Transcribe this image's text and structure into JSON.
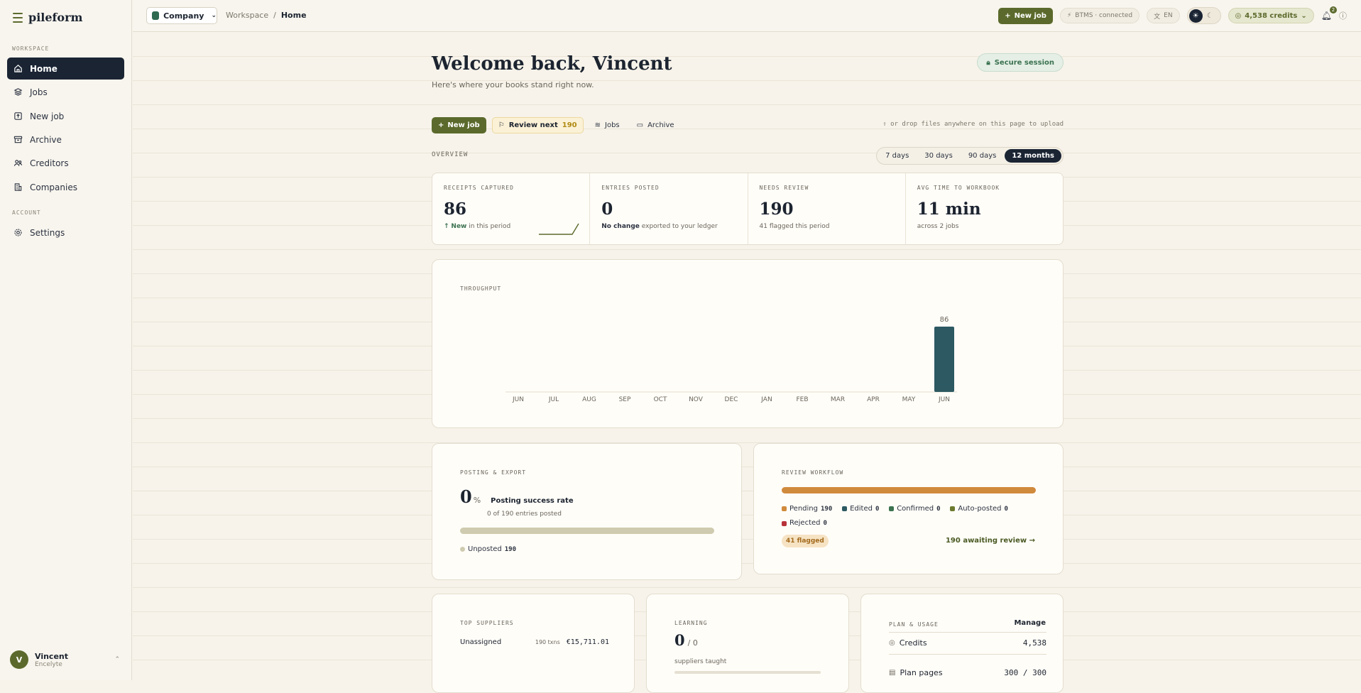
{
  "brand": {
    "name": "pileform"
  },
  "sidebar": {
    "section_workspace": "WORKSPACE",
    "section_account": "ACCOUNT",
    "items": [
      {
        "label": "Home",
        "icon": "home-icon"
      },
      {
        "label": "Jobs",
        "icon": "layers-icon"
      },
      {
        "label": "New job",
        "icon": "upload-icon"
      },
      {
        "label": "Archive",
        "icon": "archive-icon"
      },
      {
        "label": "Creditors",
        "icon": "users-icon"
      },
      {
        "label": "Companies",
        "icon": "building-icon"
      }
    ],
    "settings_label": "Settings",
    "user": {
      "initial": "V",
      "name": "Vincent",
      "company": "Encelyte"
    }
  },
  "topbar": {
    "company_label": "Company",
    "breadcrumb_parent": "Workspace",
    "breadcrumb_sep": "/",
    "breadcrumb_current": "Home",
    "new_job": "New job",
    "btms_status": "BTMS · connected",
    "language": "EN",
    "credits": "4,538 credits",
    "notifications_count": "2"
  },
  "header": {
    "title": "Welcome back, Vincent",
    "subtitle": "Here's where your books stand right now.",
    "secure_session": "Secure session"
  },
  "actions": {
    "new_job": "New job",
    "review_next": "Review next",
    "review_count": "190",
    "jobs": "Jobs",
    "archive": "Archive",
    "drop_hint": "or drop files anywhere on this page to upload"
  },
  "overview": {
    "label": "OVERVIEW",
    "periods": [
      "7 days",
      "30 days",
      "90 days",
      "12 months"
    ],
    "active_period": "12 months"
  },
  "kpis": [
    {
      "label": "RECEIPTS CAPTURED",
      "value": "86",
      "note_strong": "New",
      "note": "in this period"
    },
    {
      "label": "ENTRIES POSTED",
      "value": "0",
      "note_strong": "No change",
      "note": "exported to your ledger"
    },
    {
      "label": "NEEDS REVIEW",
      "value": "190",
      "note_strong": "",
      "note": "41 flagged this period"
    },
    {
      "label": "AVG TIME TO WORKBOOK",
      "value": "11 min",
      "note_strong": "",
      "note": "across 2 jobs"
    }
  ],
  "throughput": {
    "label": "THROUGHPUT"
  },
  "chart_data": {
    "type": "bar",
    "title": "THROUGHPUT",
    "categories": [
      "JUN",
      "JUL",
      "AUG",
      "SEP",
      "OCT",
      "NOV",
      "DEC",
      "JAN",
      "FEB",
      "MAR",
      "APR",
      "MAY",
      "JUN"
    ],
    "values": [
      0,
      0,
      0,
      0,
      0,
      0,
      0,
      0,
      0,
      0,
      0,
      0,
      86
    ],
    "data_labels": [
      "",
      "",
      "",
      "",
      "",
      "",
      "",
      "",
      "",
      "",
      "",
      "",
      "86"
    ],
    "bar_color": "#2c5962",
    "ylim": [
      0,
      86
    ]
  },
  "posting": {
    "label": "POSTING & EXPORT",
    "rate_value": "0",
    "rate_unit": "%",
    "rate_label": "Posting success rate",
    "rate_detail": "0 of 190 entries posted",
    "unposted_label": "Unposted",
    "unposted_count": "190",
    "progress_fraction": 0
  },
  "review": {
    "label": "REVIEW WORKFLOW",
    "legend": [
      {
        "label": "Pending",
        "count": "190",
        "color": "#d08a3c"
      },
      {
        "label": "Edited",
        "count": "0",
        "color": "#2c5962"
      },
      {
        "label": "Confirmed",
        "count": "0",
        "color": "#3b7250"
      },
      {
        "label": "Auto-posted",
        "count": "0",
        "color": "#6b7a2e"
      },
      {
        "label": "Rejected",
        "count": "0",
        "color": "#b8323a"
      }
    ],
    "flagged": "41 flagged",
    "awaiting": "190 awaiting review →"
  },
  "suppliers": {
    "label": "TOP SUPPLIERS",
    "rows": [
      {
        "name": "Unassigned",
        "txns": "190 txns",
        "amount": "€15,711.01"
      }
    ]
  },
  "learning": {
    "label": "LEARNING",
    "value": "0",
    "total": "/ 0",
    "note": "suppliers taught"
  },
  "plan": {
    "label": "PLAN & USAGE",
    "manage": "Manage",
    "credits_label": "Credits",
    "credits_value": "4,538",
    "pages_label": "Plan pages",
    "pages_value": "300 / 300"
  },
  "colors": {
    "accent": "#5b6a2c",
    "navy": "#1a2433",
    "background": "#f7f3ea"
  }
}
